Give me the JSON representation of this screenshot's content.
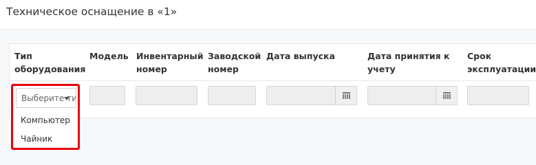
{
  "page": {
    "title": "Техническое оснащение в «1»"
  },
  "table": {
    "columns": [
      {
        "line1": "Тип",
        "line2": "оборудования"
      },
      {
        "line1": "Модель",
        "line2": ""
      },
      {
        "line1": "Инвентарный",
        "line2": "номер"
      },
      {
        "line1": "Заводской",
        "line2": "номер"
      },
      {
        "line1": "Дата выпуска",
        "line2": ""
      },
      {
        "line1": "Дата принятия к",
        "line2": "учету"
      },
      {
        "line1": "Срок",
        "line2": "эксплуатации"
      }
    ]
  },
  "equipment_type_select": {
    "value": "Выберите ти",
    "options": [
      "Компьютер",
      "Чайник"
    ]
  },
  "colors": {
    "highlight": "#e8000b",
    "input_bg": "#eeeeee"
  }
}
